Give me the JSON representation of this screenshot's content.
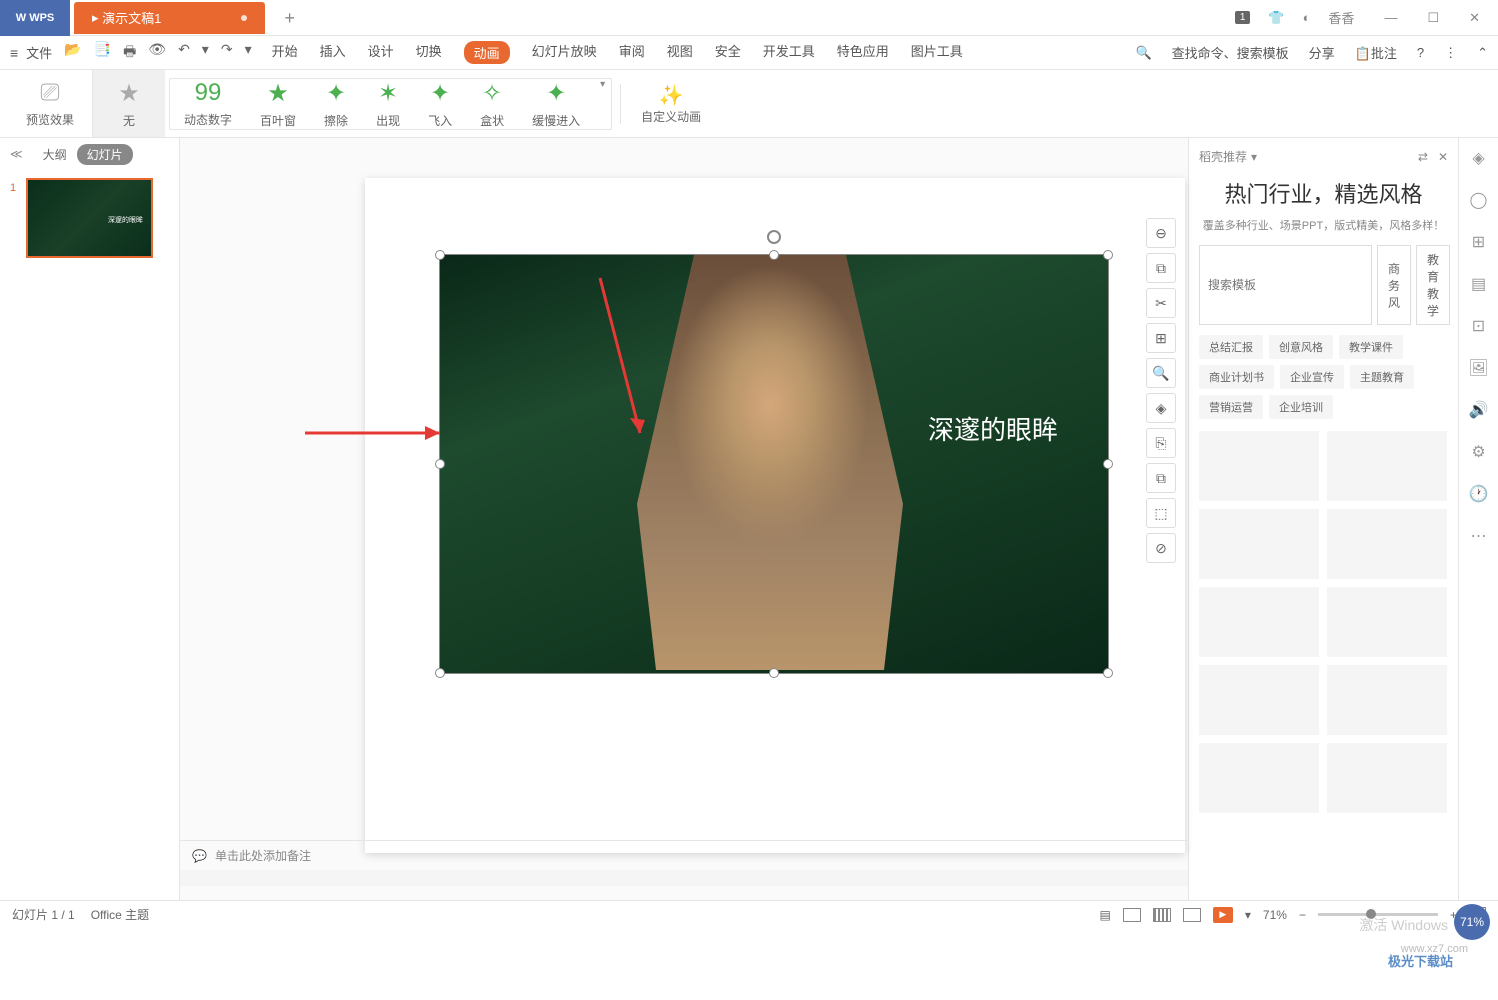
{
  "titlebar": {
    "wps": "W WPS",
    "tab": "演示文稿1",
    "add": "+",
    "user": "香香",
    "num": "1"
  },
  "menu": {
    "file": "文件",
    "tabs": [
      "开始",
      "插入",
      "设计",
      "切换",
      "动画",
      "幻灯片放映",
      "审阅",
      "视图",
      "安全",
      "开发工具",
      "特色应用",
      "图片工具"
    ],
    "active": 4,
    "search": "查找命令、搜索模板",
    "share": "分享",
    "note": "批注"
  },
  "ribbon": {
    "preview": "预览效果",
    "items": [
      "无",
      "动态数字",
      "百叶窗",
      "擦除",
      "出现",
      "飞入",
      "盒状",
      "缓慢进入"
    ],
    "custom": "自定义动画"
  },
  "panel": {
    "outline": "大纲",
    "slides": "幻灯片",
    "thumbLabel": "深邃的眼眸"
  },
  "slide": {
    "title": "深邃的眼眸"
  },
  "rightPanel": {
    "header": "稻壳推荐",
    "title": "热门行业，精选风格",
    "subtitle": "覆盖多种行业、场景PPT，版式精美，风格多样！",
    "searchPh": "搜索模板",
    "filters": [
      "商务风",
      "教育教学"
    ],
    "tags": [
      "总结汇报",
      "创意风格",
      "教学课件",
      "商业计划书",
      "企业宣传",
      "主题教育",
      "营销运营",
      "企业培训"
    ]
  },
  "notes": {
    "placeholder": "单击此处添加备注"
  },
  "status": {
    "slide": "幻灯片 1 / 1",
    "theme": "Office 主题",
    "zoom": "71%",
    "fit": "+"
  },
  "activate": "激活 Windows",
  "watermark": "www.xz7.com",
  "jiguang": "极光下载站",
  "badge": "71%"
}
